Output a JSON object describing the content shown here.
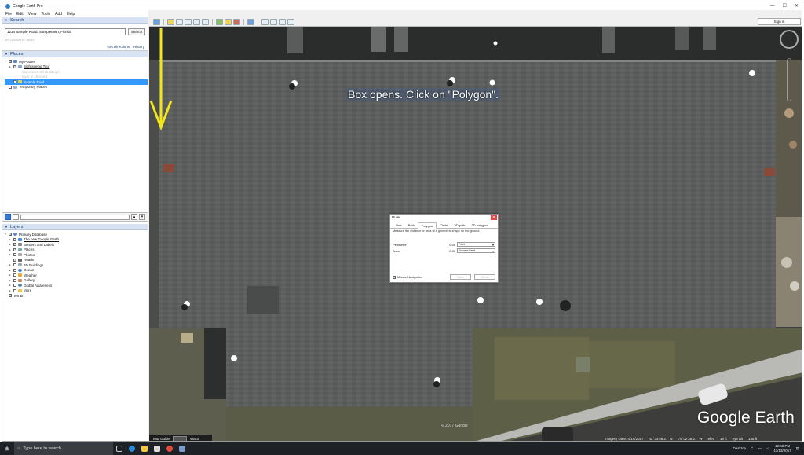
{
  "window": {
    "title": "Google Earth Pro"
  },
  "menu": [
    "File",
    "Edit",
    "View",
    "Tools",
    "Add",
    "Help"
  ],
  "search": {
    "header": "Search",
    "value": "1234 Sample Road, Sampletown, Florida",
    "button": "Search",
    "hint": "ex. 11 64505    ex. 94043",
    "get_directions": "Get Directions",
    "history": "History"
  },
  "places": {
    "header": "Places",
    "items": [
      {
        "label": "My Places",
        "checked": true,
        "level": 0
      },
      {
        "label": "Sightseeing Tour",
        "checked": true,
        "level": 1
      },
      {
        "label": "Make sure 3D Buildings",
        "checked": false,
        "level": 2,
        "faded": true
      },
      {
        "label": "layer is checked",
        "checked": false,
        "level": 2,
        "faded": true
      },
      {
        "label": "Sample Roof",
        "checked": true,
        "level": 1,
        "selected": true
      },
      {
        "label": "Temporary Places",
        "checked": false,
        "level": 0
      }
    ]
  },
  "layers": {
    "header": "Layers",
    "items": [
      {
        "label": "Primary Database",
        "level": 0
      },
      {
        "label": "The new Google Earth",
        "level": 1
      },
      {
        "label": "Borders and Labels",
        "level": 1
      },
      {
        "label": "Places",
        "level": 1
      },
      {
        "label": "Photos",
        "level": 1
      },
      {
        "label": "Roads",
        "level": 1
      },
      {
        "label": "3D Buildings",
        "level": 1
      },
      {
        "label": "Ocean",
        "level": 1
      },
      {
        "label": "Weather",
        "level": 1
      },
      {
        "label": "Gallery",
        "level": 1
      },
      {
        "label": "Global Awareness",
        "level": 1
      },
      {
        "label": "More",
        "level": 1
      },
      {
        "label": "Terrain",
        "level": 0
      }
    ]
  },
  "toolbar": {
    "sign_in": "Sign in"
  },
  "annotation": "Box opens. Click on \"Polygon\".",
  "ruler": {
    "title": "Ruler",
    "tabs": [
      "Line",
      "Path",
      "Polygon",
      "Circle",
      "3D path",
      "3D polygon"
    ],
    "active_tab": "Polygon",
    "description": "Measure the distance or area of a geometric shape on the ground",
    "perimeter_label": "Perimeter:",
    "perimeter_value": "0.00",
    "perimeter_unit": "Feet",
    "area_label": "Area:",
    "area_value": "0.00",
    "area_unit": "Square Feet",
    "mouse_navigation": "Mouse Navigation",
    "save": "Save",
    "clear": "Clear"
  },
  "map": {
    "logo": "Google Earth",
    "copyright": "© 2017 Google",
    "tour_guide": "Tour Guide",
    "tour_thumb": "Waco"
  },
  "status": {
    "imagery_date": "Imagery Date: 4/14/2017",
    "lat": "42°33'58.27\" N",
    "lon": "75°02'35.27\" W",
    "elev": "elev",
    "elev_val": "18 ft",
    "eye_alt": "eye alt",
    "eye_val": "135 ft"
  },
  "taskbar": {
    "search_placeholder": "Type here to search",
    "desktop": "Desktop",
    "time": "12:58 PM",
    "date": "11/13/2017"
  }
}
